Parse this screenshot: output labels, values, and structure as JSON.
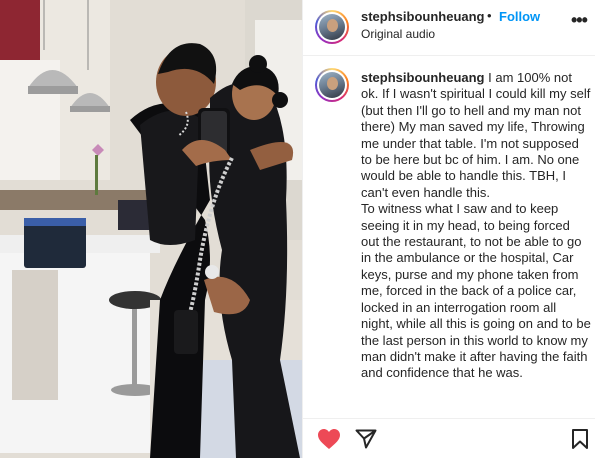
{
  "post": {
    "username": "stephsibounheuang",
    "separator": "•",
    "follow_label": "Follow",
    "audio": "Original audio",
    "more_label": "•••"
  },
  "caption": {
    "username": "stephsibounheuang",
    "paragraph1": "I am 100% not ok. If I wasn't spiritual I could kill my self (but then I'll go to hell and my man not there) My man saved my life, Throwing me under that table. I'm not supposed to be here but bc of him. I am. No one would be able to handle this. TBH, I can't even handle this.",
    "paragraph2": "To witness what I saw and to keep seeing it in my head, to being forced out the restaurant, to not be able to go in the ambulance or the hospital, Car keys, purse and my phone taken from me, forced in the back of a police car, locked in an interrogation room all night, while all this is going on and to be the last person in this world to know my man didn't make it after having the faith and confidence that he was."
  },
  "icons": {
    "like": "heart-icon",
    "share": "paper-plane-icon",
    "save": "bookmark-icon",
    "more": "ellipsis-icon"
  },
  "colors": {
    "like": "#ed4956",
    "follow": "#0095f6",
    "text": "#262626"
  }
}
